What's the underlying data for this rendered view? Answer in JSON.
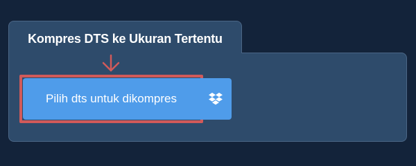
{
  "tool": {
    "title": "Kompres DTS ke Ukuran Tertentu"
  },
  "upload": {
    "button_label": "Pilih dts untuk dikompres",
    "dropbox_icon": "dropbox-icon"
  },
  "colors": {
    "background": "#13233a",
    "panel": "#2e4b6b",
    "button": "#4f9cea",
    "highlight": "#d15a5a"
  }
}
